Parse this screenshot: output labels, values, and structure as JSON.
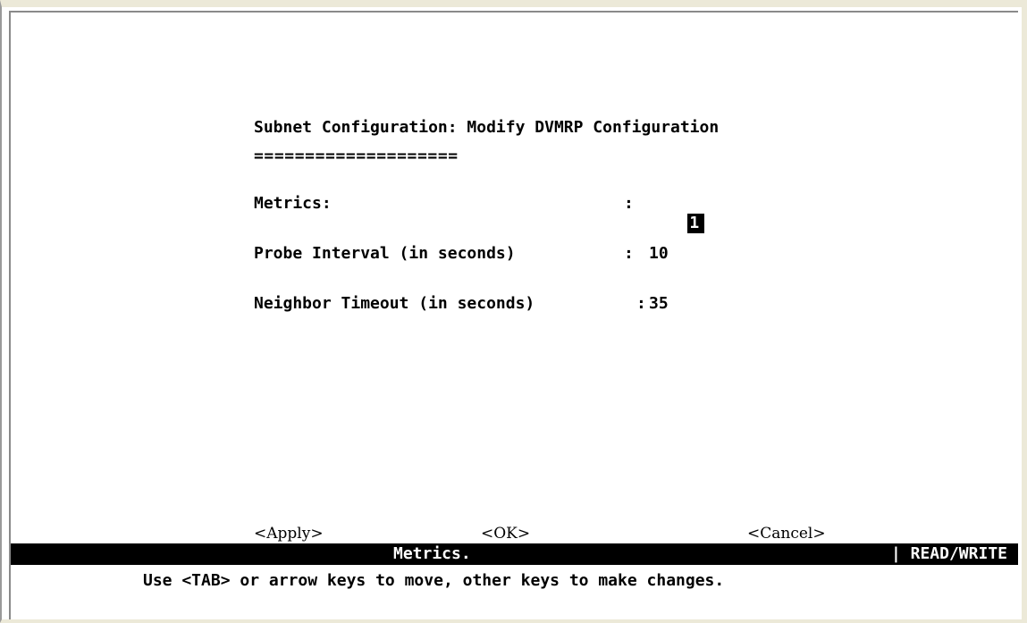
{
  "screen": {
    "title": "Subnet Configuration: Modify DVMRP Configuration",
    "title_underline": "===================="
  },
  "fields": [
    {
      "label": "Metrics:",
      "colon": ":",
      "value": "1"
    },
    {
      "label": "Probe Interval (in seconds)",
      "colon": ":",
      "value": "10"
    },
    {
      "label": "Neighbor Timeout (in seconds)",
      "colon": ":",
      "value": "35"
    }
  ],
  "buttons": {
    "apply": "<Apply>",
    "ok": "<OK>",
    "cancel": "<Cancel>"
  },
  "status_bar": {
    "message": "Metrics.",
    "mode": "| READ/WRITE"
  },
  "help_text": "Use <TAB> or arrow keys to move, other keys to make changes.",
  "colors": {
    "background": "#ffffff",
    "text": "#000000",
    "status_bar_bg": "#000000",
    "status_bar_text": "#ffffff",
    "frame": "#ece9d8"
  }
}
